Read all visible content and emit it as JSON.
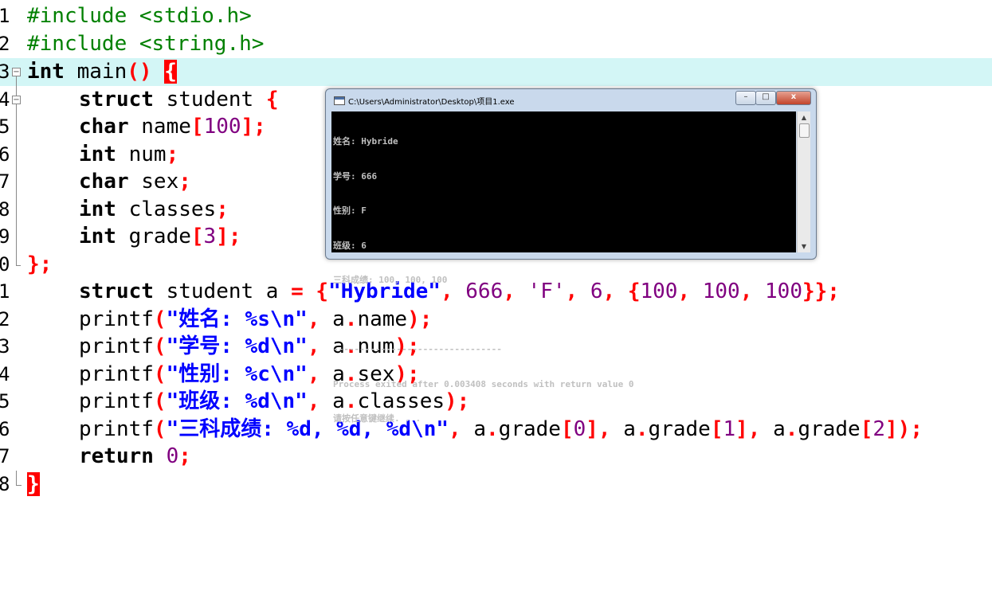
{
  "editor": {
    "line_numbers": [
      "1",
      "2",
      "3",
      "4",
      "5",
      "6",
      "7",
      "8",
      "9",
      "0",
      "1",
      "2",
      "3",
      "4",
      "5",
      "6",
      "7",
      "8"
    ],
    "current_line": 3,
    "tokens": {
      "l1": "#include <stdio.h>",
      "l2": "#include <string.h>",
      "l3_kw": "int",
      "l3_name": " main",
      "l3_paren": "()",
      "l3_brace": "{",
      "l4_kw": "struct",
      "l4_name": " student ",
      "l4_brace": "{",
      "l5_kw": "char",
      "l5_name": " name",
      "l5_lb": "[",
      "l5_num": "100",
      "l5_rb": "];",
      "l6_kw": "int",
      "l6_name": " num",
      "l6_semi": ";",
      "l7_kw": "char",
      "l7_name": " sex",
      "l7_semi": ";",
      "l8_kw": "int",
      "l8_name": " classes",
      "l8_semi": ";",
      "l9_kw": "int",
      "l9_name": " grade",
      "l9_lb": "[",
      "l9_num": "3",
      "l9_rb": "];",
      "l10_close": "};",
      "l11_kw": "struct",
      "l11_a": " student a ",
      "l11_eq": "=",
      "l11_sp": " ",
      "l11_lb": "{",
      "l11_str": "\"Hybride\"",
      "l11_c1": ",",
      "l11_num1": " 666",
      "l11_c2": ",",
      "l11_ch": " 'F'",
      "l11_c3": ",",
      "l11_num2": " 6",
      "l11_c4": ",",
      "l11_sp2": " ",
      "l11_lb2": "{",
      "l11_g1": "100",
      "l11_c5": ",",
      "l11_g2": " 100",
      "l11_c6": ",",
      "l11_g3": " 100",
      "l11_end": "}};",
      "l12_fn": "printf",
      "l12_lp": "(",
      "l12_str": "\"姓名: %s\\n\"",
      "l12_c": ",",
      "l12_arg1": " a",
      "l12_dot": ".",
      "l12_arg2": "name",
      "l12_end": ");",
      "l13_fn": "printf",
      "l13_lp": "(",
      "l13_str": "\"学号: %d\\n\"",
      "l13_c": ",",
      "l13_arg1": " a",
      "l13_dot": ".",
      "l13_arg2": "num",
      "l13_end": ");",
      "l14_fn": "printf",
      "l14_lp": "(",
      "l14_str": "\"性别: %c\\n\"",
      "l14_c": ",",
      "l14_arg1": " a",
      "l14_dot": ".",
      "l14_arg2": "sex",
      "l14_end": ");",
      "l15_fn": "printf",
      "l15_lp": "(",
      "l15_str": "\"班级: %d\\n\"",
      "l15_c": ",",
      "l15_arg1": " a",
      "l15_dot": ".",
      "l15_arg2": "classes",
      "l15_end": ");",
      "l16_fn": "printf",
      "l16_lp": "(",
      "l16_str": "\"三科成绩: %d, %d, %d\\n\"",
      "l16_c": ",",
      "l16_a1": " a",
      "l16_d1": ".",
      "l16_g1": "grade",
      "l16_b1": "[",
      "l16_i1": "0",
      "l16_e1": "],",
      "l16_a2": " a",
      "l16_d2": ".",
      "l16_g2": "grade",
      "l16_b2": "[",
      "l16_i2": "1",
      "l16_e2": "],",
      "l16_a3": " a",
      "l16_d3": ".",
      "l16_g3": "grade",
      "l16_b3": "[",
      "l16_i3": "2",
      "l16_end": "]);",
      "l17_kw": "return",
      "l17_sp": " ",
      "l17_num": "0",
      "l17_semi": ";",
      "l18_brace": "}"
    }
  },
  "console": {
    "title": "C:\\Users\\Administrator\\Desktop\\项目1.exe",
    "min_label": "–",
    "max_label": "□",
    "close_label": "x",
    "output": [
      "姓名: Hybride",
      "学号: 666",
      "性别: F",
      "班级: 6",
      "三科成绩: 100, 100, 100",
      "",
      "--------------------------------",
      "Process exited after 0.003408 seconds with return value 0",
      "请按任意键继续. . ."
    ]
  },
  "colors": {
    "current_line_bg": "#d3f6f6",
    "preprocessor": "#008000",
    "operator": "#ff0000",
    "number": "#800080",
    "string": "#0000ff",
    "console_bg": "#000000",
    "console_fg": "#c0c0c0"
  },
  "icons": {
    "fold_open": "fold-minus-icon",
    "console_app": "console-app-icon"
  }
}
